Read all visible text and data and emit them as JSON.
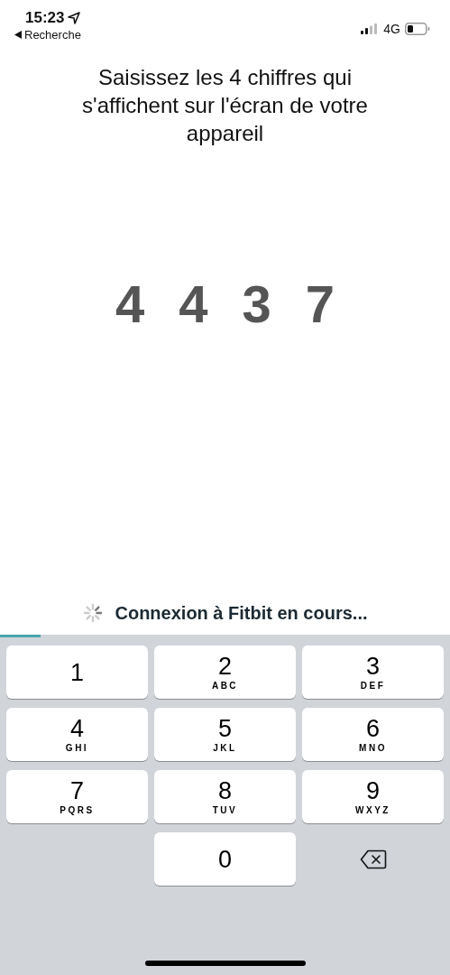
{
  "status_bar": {
    "time": "15:23",
    "back_label": "Recherche",
    "network": "4G"
  },
  "instruction": "Saisissez les 4 chiffres qui s'affichent sur l'écran de votre appareil",
  "code_digits": [
    "4",
    "4",
    "3",
    "7"
  ],
  "connection": {
    "message": "Connexion à Fitbit en cours...",
    "level": 0.09
  },
  "keypad": [
    {
      "kind": "digit",
      "digit": "1"
    },
    {
      "kind": "digit",
      "digit": "2",
      "letters": "ABC"
    },
    {
      "kind": "digit",
      "digit": "3",
      "letters": "DEF"
    },
    {
      "kind": "digit",
      "digit": "4",
      "letters": "GHI"
    },
    {
      "kind": "digit",
      "digit": "5",
      "letters": "JKL"
    },
    {
      "kind": "digit",
      "digit": "6",
      "letters": "MNO"
    },
    {
      "kind": "digit",
      "digit": "7",
      "letters": "PQRS"
    },
    {
      "kind": "digit",
      "digit": "8",
      "letters": "TUV"
    },
    {
      "kind": "digit",
      "digit": "9",
      "letters": "WXYZ"
    },
    {
      "kind": "empty"
    },
    {
      "kind": "digit",
      "digit": "0"
    },
    {
      "kind": "delete"
    }
  ]
}
